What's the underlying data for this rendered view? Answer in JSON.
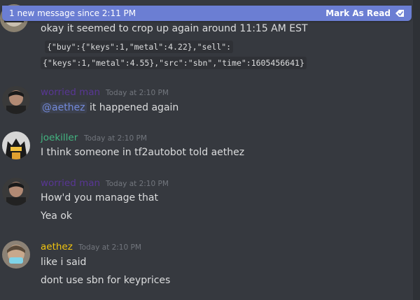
{
  "banner": {
    "text": "1 new message since 2:11 PM",
    "action_label": "Mark As Read"
  },
  "colors": {
    "background": "#36393f",
    "banner": "#6b7ed3",
    "worried_man": "#593695",
    "joekiller": "#43b581",
    "aethez": "#f1c40f",
    "mention": "#7289da",
    "timestamp": "#72767d"
  },
  "messages": [
    {
      "lines": [
        "okay it seemed to crop up again around 11:15 AM EST"
      ],
      "code_lines": [
        "{\"buy\":{\"keys\":1,\"metal\":4.22},\"sell\":",
        "{\"keys\":1,\"metal\":4.55},\"src\":\"sbn\",\"time\":1605456641}"
      ]
    },
    {
      "author": "worried man",
      "timestamp": "Today at 2:10 PM",
      "mention": "@aethez",
      "mention_rest": " it happened again"
    },
    {
      "author": "joekiller",
      "timestamp": "Today at 2:10 PM",
      "lines": [
        "I think someone in tf2autobot told aethez"
      ]
    },
    {
      "author": "worried man",
      "timestamp": "Today at 2:10 PM",
      "lines": [
        "How'd you manage that",
        "Yea ok"
      ]
    },
    {
      "author": "aethez",
      "timestamp": "Today at 2:10 PM",
      "lines": [
        "like i said",
        "dont use sbn for keyprices"
      ]
    }
  ]
}
